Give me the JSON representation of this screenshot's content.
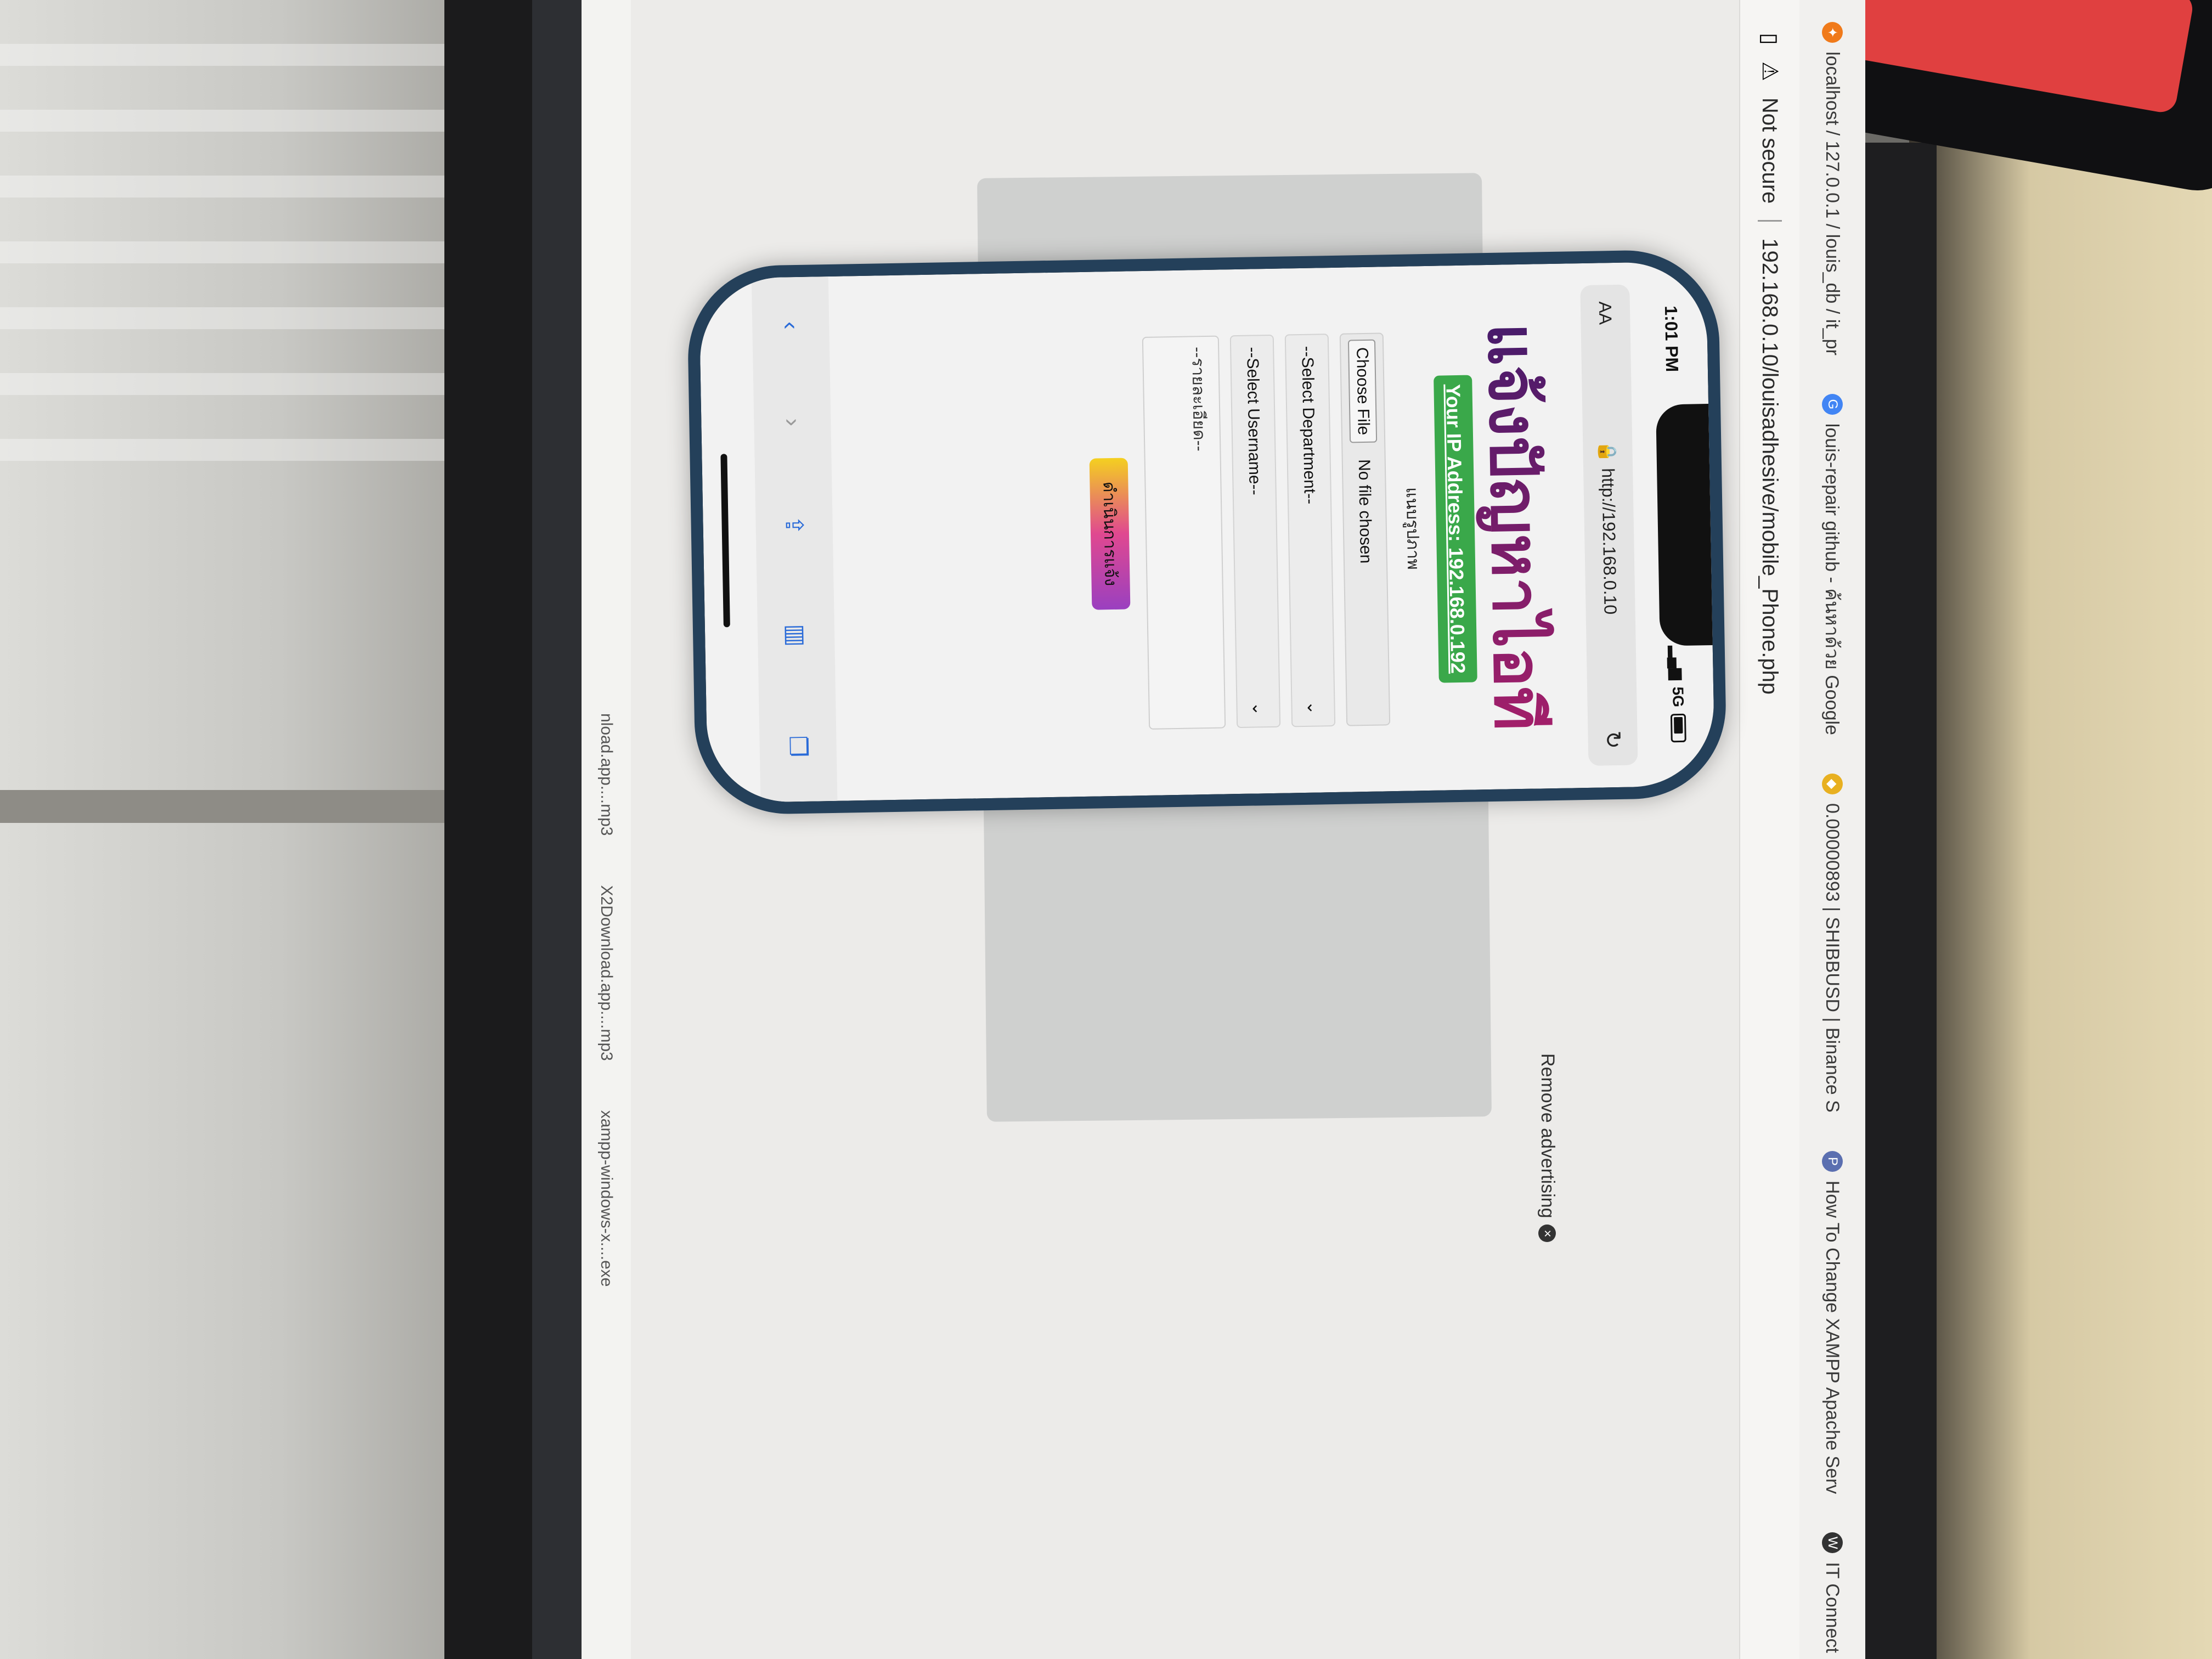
{
  "bookmarks": [
    {
      "icon": "xampp-icon",
      "label": "localhost / 127.0.0.1 / louis_db / it_pr"
    },
    {
      "icon": "google-icon",
      "label": "louis-repair github - ค้นหาด้วย Google"
    },
    {
      "icon": "binance-icon",
      "label": "0.00000893 | SHIBBUSD | Binance S"
    },
    {
      "icon": "php-icon",
      "label": "How To Change XAMPP Apache Serv"
    },
    {
      "icon": "wordpress-icon",
      "label": "IT Connect"
    }
  ],
  "address_bar": {
    "security": "Not secure",
    "url": "192.168.0.10/louisadhesive/mobile_Phone.php"
  },
  "ad": {
    "remove_label": "Remove advertising"
  },
  "downloads": [
    {
      "label": "nload.app....mp3"
    },
    {
      "label": "X2Download.app....mp3"
    },
    {
      "label": "xampp-windows-x....exe"
    }
  ],
  "phone": {
    "status_time": "1:01 PM",
    "network": "5G",
    "url_aa": "AA",
    "url": "http://192.168.0.10",
    "title": "แจ้งปัญหาไอที",
    "ip_badge": "Your IP Address: 192.168.0.192",
    "image_label": "แนบรูปภาพ",
    "file_button": "Choose File",
    "file_status": "No file chosen",
    "department_placeholder": "--Select Department--",
    "username_placeholder": "--Select Username--",
    "details_placeholder": "--รายละเอียด--",
    "submit_label": "ดำเนินการแจ้ง"
  }
}
